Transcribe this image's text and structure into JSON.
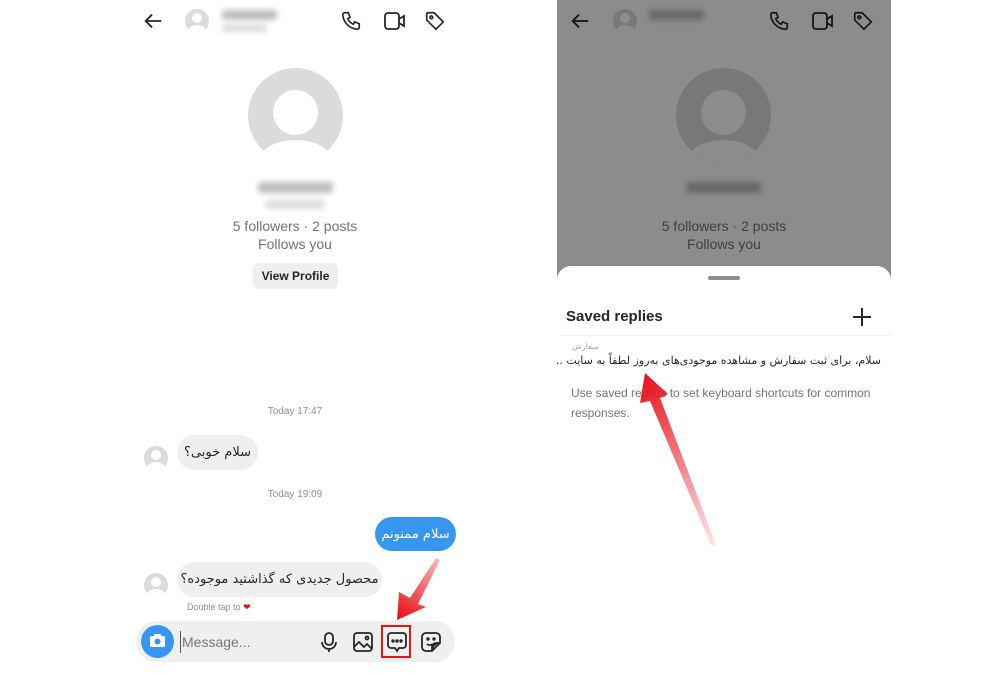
{
  "profile": {
    "stats": "5 followers · 2 posts",
    "relation": "Follows you",
    "view_profile_label": "View Profile"
  },
  "header_icons": [
    "back-arrow-icon",
    "phone-icon",
    "video-icon",
    "tag-icon"
  ],
  "messages": [
    {
      "timestamp": "Today 17:47"
    },
    {
      "from": "them",
      "text": "سلام خوبی؟"
    },
    {
      "timestamp": "Today 19:09"
    },
    {
      "from": "me",
      "text": "سلام ممنونم"
    },
    {
      "from": "them",
      "text": "محصول جدیدی که گذاشتید موجوده؟"
    }
  ],
  "double_tap_hint": "Double tap to",
  "composer": {
    "placeholder": "Message...",
    "icons": [
      "camera-icon",
      "mic-icon",
      "image-icon",
      "saved-replies-icon",
      "sticker-icon"
    ]
  },
  "saved_replies": {
    "title": "Saved replies",
    "add_icon": "plus-icon",
    "items": [
      {
        "shortcut": "سفارش",
        "text": "سلام، برای ثبت سفارش و مشاهده موجودی‌های به‌روز لطفاً به سایت ..."
      }
    ],
    "help_text": "Use saved replies to set keyboard shortcuts for common responses."
  },
  "colors": {
    "accent_blue": "#3797f0",
    "highlight_red": "#e8121b",
    "bubble_gray": "#efefef"
  }
}
